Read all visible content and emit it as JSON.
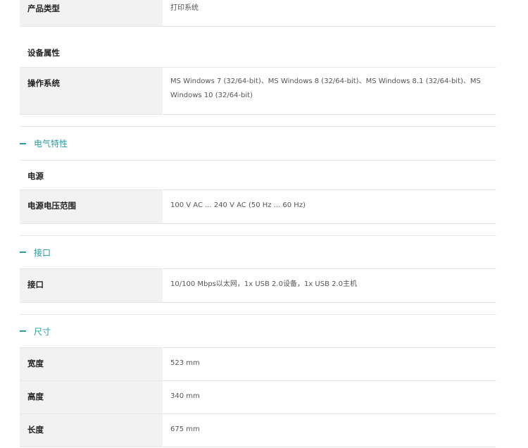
{
  "top_row": {
    "label": "产品类型",
    "value": "打印系统"
  },
  "device_props": {
    "heading": "设备属性",
    "rows": [
      {
        "label": "操作系统",
        "value": "MS Windows 7 (32/64-bit)、MS Windows 8 (32/64-bit)、MS Windows 8.1 (32/64-bit)、MS Windows 10 (32/64-bit)"
      }
    ]
  },
  "electrical": {
    "title": "电气特性",
    "subheading": "电源",
    "rows": [
      {
        "label": "电源电压范围",
        "value": "100 V AC ... 240 V AC (50 Hz ... 60 Hz)"
      }
    ]
  },
  "interface": {
    "title": "接口",
    "rows": [
      {
        "label": "接口",
        "value": "10/100 Mbps以太网，1x USB 2.0设备，1x USB 2.0主机"
      }
    ]
  },
  "dimensions": {
    "title": "尺寸",
    "rows": [
      {
        "label": "宽度",
        "value": "523 mm"
      },
      {
        "label": "高度",
        "value": "340 mm"
      },
      {
        "label": "长度",
        "value": "675 mm"
      }
    ]
  },
  "colors": {
    "accent": "#2a9aa6",
    "label_bg": "#f2f2f2",
    "border": "#e7e7e7"
  }
}
